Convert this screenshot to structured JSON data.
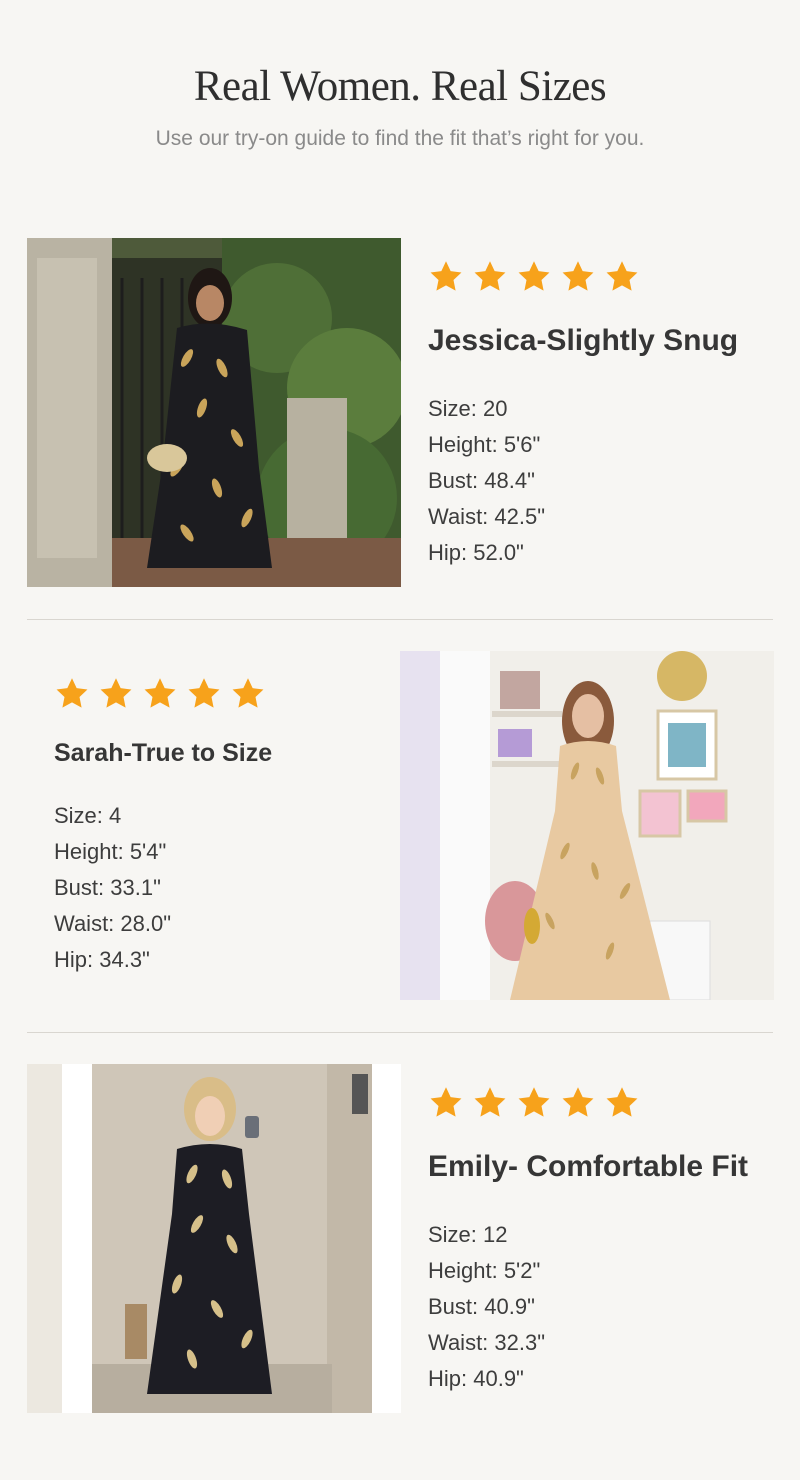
{
  "header": {
    "title": "Real Women. Real Sizes",
    "subtitle": "Use our try-on guide to find the fit that’s right for you."
  },
  "reviews": [
    {
      "name": "Jessica-Slightly Snug",
      "rating": 5,
      "specs": [
        "Size: 20",
        "Height: 5'6\"",
        "Bust: 48.4\"",
        "Waist: 42.5\"",
        "Hip: 52.0\""
      ]
    },
    {
      "name": "Sarah-True to Size",
      "rating": 5,
      "specs": [
        "Size: 4",
        "Height: 5'4\"",
        "Bust: 33.1\"",
        "Waist: 28.0\"",
        "Hip: 34.3\""
      ]
    },
    {
      "name": "Emily- Comfortable Fit",
      "rating": 5,
      "specs": [
        "Size: 12",
        "Height: 5'2\"",
        "Bust: 40.9\"",
        "Waist: 32.3\"",
        "Hip: 40.9\""
      ]
    }
  ],
  "colors": {
    "star": "#f7a21b",
    "background": "#f7f6f3",
    "divider": "#d9d6d0"
  },
  "icons": {
    "rating": "star-icon"
  }
}
